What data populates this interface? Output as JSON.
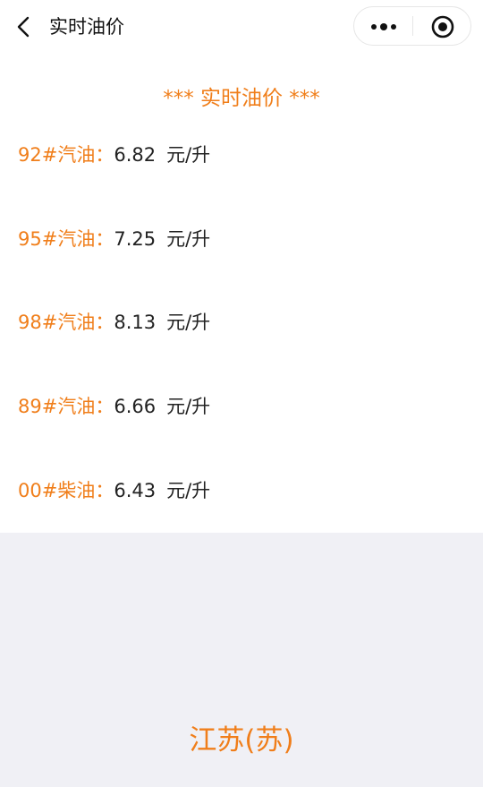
{
  "navbar": {
    "title": "实时油价",
    "back_icon": "chevron-left-icon",
    "more_icon": "more-dots-icon",
    "close_icon": "target-circle-icon"
  },
  "heading": "*** 实时油价 ***",
  "prices": [
    {
      "fuel": "92#汽油：",
      "price": "6.82",
      "unit": "元/升"
    },
    {
      "fuel": "95#汽油：",
      "price": "7.25",
      "unit": "元/升"
    },
    {
      "fuel": "98#汽油：",
      "price": "8.13",
      "unit": "元/升"
    },
    {
      "fuel": "89#汽油：",
      "price": "6.66",
      "unit": "元/升"
    },
    {
      "fuel": "00#柴油：",
      "price": "6.43",
      "unit": "元/升"
    }
  ],
  "province": "江苏(苏)",
  "colors": {
    "accent": "#f07e1a",
    "text": "#222222",
    "bottom_bg": "#f0f0f5"
  }
}
